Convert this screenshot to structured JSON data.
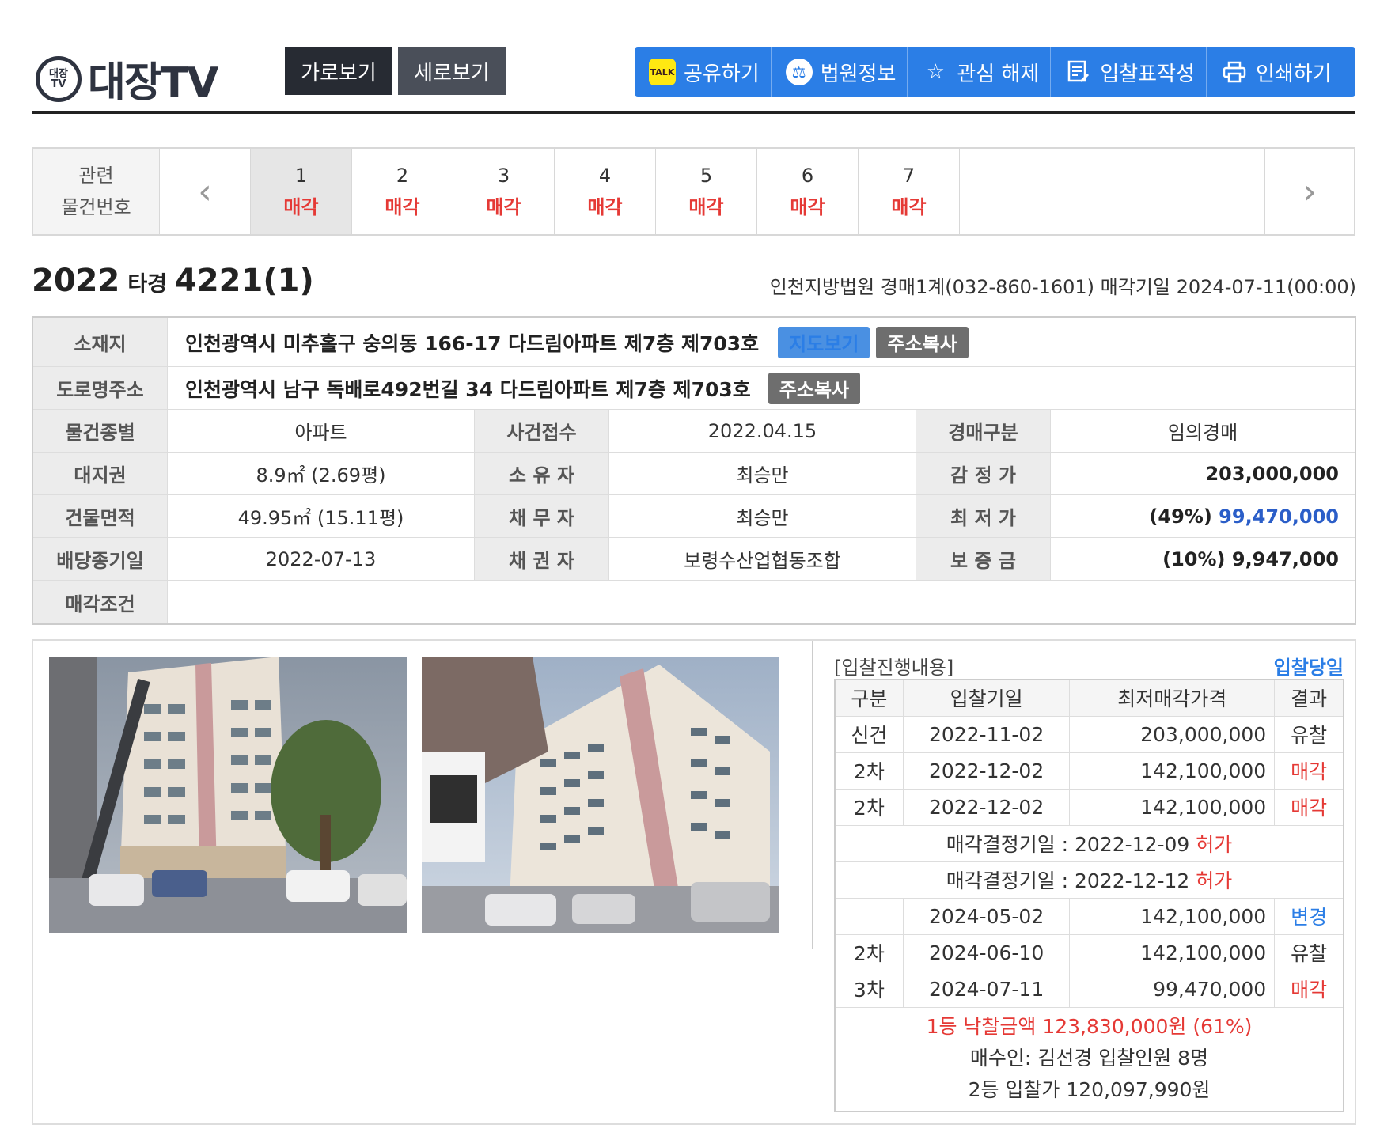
{
  "header": {
    "logo_badge": "대장TV",
    "logo_text": "대장TV",
    "view_buttons": [
      "가로보기",
      "세로보기"
    ],
    "tools": [
      {
        "label": "공유하기",
        "icon": "kakaotalk-icon"
      },
      {
        "label": "법원정보",
        "icon": "court-icon"
      },
      {
        "label": "관심 해제",
        "icon": "star-icon"
      },
      {
        "label": "입찰표작성",
        "icon": "document-edit-icon"
      },
      {
        "label": "인쇄하기",
        "icon": "printer-icon"
      }
    ]
  },
  "related": {
    "label_line1": "관련",
    "label_line2": "물건번호",
    "items": [
      {
        "num": "1",
        "status": "매각"
      },
      {
        "num": "2",
        "status": "매각"
      },
      {
        "num": "3",
        "status": "매각"
      },
      {
        "num": "4",
        "status": "매각"
      },
      {
        "num": "5",
        "status": "매각"
      },
      {
        "num": "6",
        "status": "매각"
      },
      {
        "num": "7",
        "status": "매각"
      }
    ]
  },
  "case": {
    "year": "2022",
    "type": "타경",
    "number": "4221(1)",
    "info": "인천지방법원 경매1계(032-860-1601) 매각기일 2024-07-11(00:00)"
  },
  "info": {
    "location_label": "소재지",
    "location": "인천광역시 미추홀구 숭의동 166-17 다드림아파트 제7층 제703호",
    "map_button": "지도보기",
    "copy_button": "주소복사",
    "road_label": "도로명주소",
    "road": "인천광역시 남구 독배로492번길 34 다드림아파트 제7층 제703호",
    "rows": [
      {
        "l1": "물건종별",
        "v1": "아파트",
        "l2": "사건접수",
        "v2": "2022.04.15",
        "l3": "경매구분",
        "v3": "임의경매"
      },
      {
        "l1": "대지권",
        "v1": "8.9㎡ (2.69평)",
        "l2": "소 유 자",
        "v2": "최승만",
        "l3": "감 정 가",
        "v3": "203,000,000"
      },
      {
        "l1": "건물면적",
        "v1": "49.95㎡ (15.11평)",
        "l2": "채 무 자",
        "v2": "최승만",
        "l3": "최 저 가",
        "v3_pct": "(49%)",
        "v3": "99,470,000"
      },
      {
        "l1": "배당종기일",
        "v1": "2022-07-13",
        "l2": "채 권 자",
        "v2": "보령수산업협동조합",
        "l3": "보 증 금",
        "v3": "(10%) 9,947,000"
      }
    ],
    "condition_label": "매각조건",
    "condition": ""
  },
  "bid": {
    "caption": "[입찰진행내용]",
    "day_link": "입찰당일",
    "columns": [
      "구분",
      "입찰기일",
      "최저매각가격",
      "결과"
    ],
    "rows": [
      {
        "kind": "신건",
        "date": "2022-11-02",
        "price": "203,000,000",
        "result": "유찰",
        "color": "normal"
      },
      {
        "kind": "2차",
        "date": "2022-12-02",
        "price": "142,100,000",
        "result": "매각",
        "color": "red"
      },
      {
        "kind": "2차",
        "date": "2022-12-02",
        "price": "142,100,000",
        "result": "매각",
        "color": "red"
      }
    ],
    "decisions": [
      {
        "text": "매각결정기일 : 2022-12-09",
        "status": "허가"
      },
      {
        "text": "매각결정기일 : 2022-12-12",
        "status": "허가"
      }
    ],
    "rows2": [
      {
        "kind": "",
        "date": "2024-05-02",
        "price": "142,100,000",
        "result": "변경",
        "color": "blue"
      },
      {
        "kind": "2차",
        "date": "2024-06-10",
        "price": "142,100,000",
        "result": "유찰",
        "color": "normal"
      },
      {
        "kind": "3차",
        "date": "2024-07-11",
        "price": "99,470,000",
        "result": "매각",
        "color": "red"
      }
    ],
    "winning": "1등 낙찰금액 123,830,000원 (61%)",
    "buyer": "매수인: 김선경 입찰인원 8명",
    "second": "2등 입찰가 120,097,990원"
  }
}
